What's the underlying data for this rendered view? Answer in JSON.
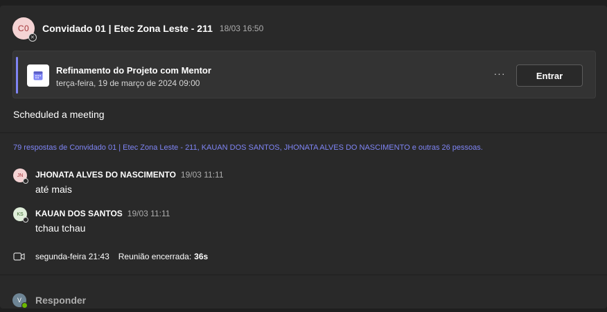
{
  "post": {
    "author_initials": "C0",
    "author": "Convidado 01 | Etec Zona Leste - 211",
    "timestamp": "18/03 16:50",
    "status_icon": "offline-x-icon",
    "text": "Scheduled a meeting"
  },
  "meeting_card": {
    "icon": "calendar-icon",
    "accent_color": "#7f85f5",
    "title": "Refinamento do Projeto com Mentor",
    "date": "terça-feira, 19 de março de 2024 09:00",
    "more_label": "···",
    "join_label": "Entrar"
  },
  "replies": {
    "summary": "79 respostas de Convidado 01 | Etec Zona Leste - 211, KAUAN DOS SANTOS, JHONATA ALVES DO NASCIMENTO e outras 26 pessoas.",
    "items": [
      {
        "initials": "JN",
        "author": "JHONATA ALVES DO NASCIMENTO",
        "time": "19/03 11:11",
        "text": "até mais"
      },
      {
        "initials": "KS",
        "author": "KAUAN DOS SANTOS",
        "time": "19/03 11:11",
        "text": "tchau tchau"
      }
    ]
  },
  "call_event": {
    "icon": "video-camera-icon",
    "time": "segunda-feira 21:43",
    "status": "Reunião encerrada:",
    "duration": "36s"
  },
  "reply_box": {
    "user_initial": "V",
    "presence": "available",
    "placeholder": "Responder"
  },
  "colors": {
    "background": "#1f1f1f",
    "card": "#292929",
    "link": "#7f85f5",
    "online": "#6bb700"
  }
}
